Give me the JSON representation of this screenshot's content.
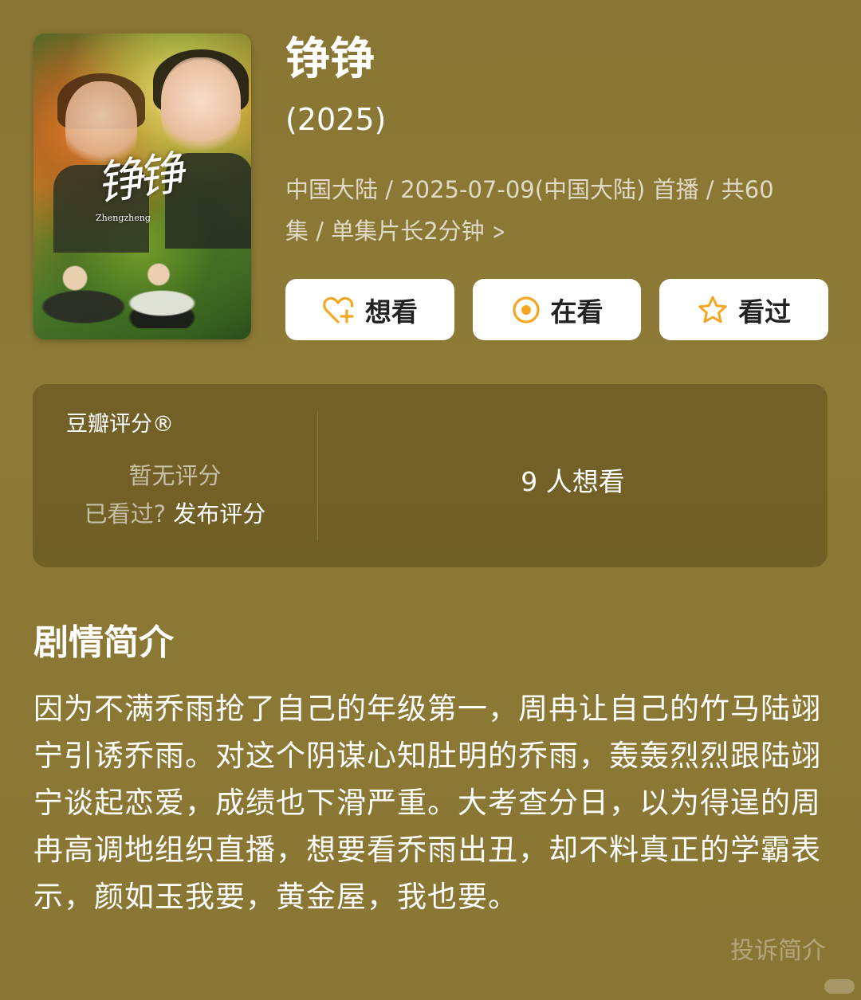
{
  "movie": {
    "title": "铮铮",
    "year": "(2025)",
    "meta_line1": "中国大陆 / 2025-07-09(中国大陆) 首播 / 共60",
    "meta_line2": "集 / 单集片长2分钟"
  },
  "poster": {
    "art_title": "铮铮",
    "art_subtitle": "Zhengzheng"
  },
  "actions": [
    {
      "label": "想看",
      "icon": "heart-plus-icon"
    },
    {
      "label": "在看",
      "icon": "target-circle-icon"
    },
    {
      "label": "看过",
      "icon": "star-icon"
    }
  ],
  "rating": {
    "title": "豆瓣评分®",
    "none_text": "暂无评分",
    "watched_question": "已看过?",
    "publish_link": "发布评分",
    "want_count_text": "9 人想看"
  },
  "synopsis": {
    "heading": "剧情简介",
    "text": "因为不满乔雨抢了自己的年级第一，周冉让自己的竹马陆翊宁引诱乔雨。对这个阴谋心知肚明的乔雨，轰轰烈烈跟陆翊宁谈起恋爱，成绩也下滑严重。大考查分日，以为得逞的周冉高调地组织直播，想要看乔雨出丑，却不料真正的学霸表示，颜如玉我要，黄金屋，我也要。",
    "complaint_link": "投诉简介"
  },
  "colors": {
    "accent": "#f5a623",
    "background": "#8b7734"
  }
}
